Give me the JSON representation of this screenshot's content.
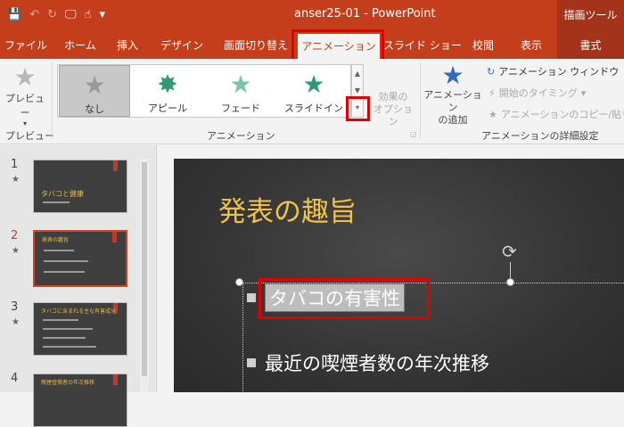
{
  "window": {
    "title": "anser25-01 - PowerPoint",
    "context_header": "描画ツール",
    "qat": [
      {
        "icon": "save-icon",
        "glyph": "💾"
      },
      {
        "icon": "undo-icon",
        "glyph": "↶"
      },
      {
        "icon": "redo-icon",
        "glyph": "↻"
      },
      {
        "icon": "present-icon",
        "glyph": "🖵"
      },
      {
        "icon": "touch-mode-icon",
        "glyph": "☝"
      },
      {
        "icon": "customize-qat-icon",
        "glyph": "▾"
      }
    ]
  },
  "tabs": [
    {
      "label": "ファイル"
    },
    {
      "label": "ホーム"
    },
    {
      "label": "挿入"
    },
    {
      "label": "デザイン"
    },
    {
      "label": "画面切り替え"
    },
    {
      "label": "アニメーション",
      "active": true
    },
    {
      "label": "スライド ショー"
    },
    {
      "label": "校閲"
    },
    {
      "label": "表示"
    },
    {
      "label": "書式",
      "contextual": true
    }
  ],
  "ribbon": {
    "preview": {
      "button_label": "プレビュー",
      "group_label": "プレビュー"
    },
    "gallery": {
      "items": [
        {
          "label": "なし",
          "selected": true,
          "color": "#9a9a9a",
          "icon": "none-star-icon"
        },
        {
          "label": "アピール",
          "color": "#2e9b72",
          "icon": "appear-star-icon"
        },
        {
          "label": "フェード",
          "color": "#7cc4a4",
          "icon": "fade-star-icon"
        },
        {
          "label": "スライドイン",
          "color": "#2e9b72",
          "icon": "fly-in-star-icon"
        }
      ],
      "group_label": "アニメーション"
    },
    "effect_options": {
      "label_line1": "効果の",
      "label_line2": "オプション"
    },
    "add_animation": {
      "label_line1": "アニメーション",
      "label_line2": "の追加"
    },
    "advanced": {
      "animation_pane": "アニメーション ウィンドウ",
      "trigger": "開始のタイミング",
      "painter": "アニメーションのコピー/貼り付け",
      "group_label": "アニメーションの詳細設定"
    }
  },
  "slides": [
    {
      "number": "1",
      "title": "タバコと健康"
    },
    {
      "number": "2",
      "title": "発表の趣旨",
      "active": true
    },
    {
      "number": "3",
      "title": "タバコに含まれる主な有害成分"
    },
    {
      "number": "4",
      "title": "喫煙習慣者の年次推移"
    }
  ],
  "current_slide": {
    "title": "発表の趣旨",
    "bullets": [
      {
        "text": "タバコの有害性",
        "highlighted": true
      },
      {
        "text": "最近の喫煙者数の年次推移"
      }
    ]
  },
  "colors": {
    "accent": "#c43e1c",
    "highlight": "#e00000",
    "slide_title": "#f0c24b"
  }
}
